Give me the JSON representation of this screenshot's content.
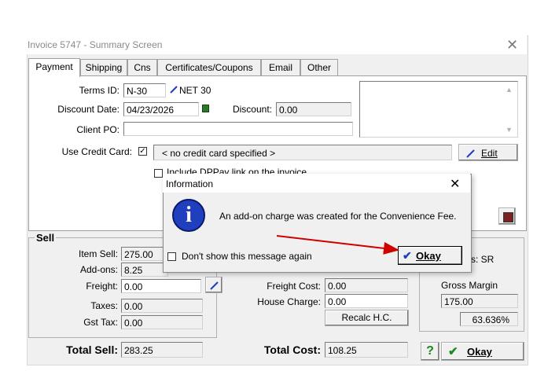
{
  "window": {
    "title": "Invoice 5747 - Summary Screen",
    "close_glyph": "✕"
  },
  "tabs": [
    "Payment",
    "Shipping",
    "Cns",
    "Certificates/Coupons",
    "Email",
    "Other"
  ],
  "payment": {
    "terms_label": "Terms ID:",
    "terms_value": "N-30",
    "terms_desc": "NET 30",
    "discount_date_label": "Discount Date:",
    "discount_date_value": "04/23/2026",
    "discount_label": "Discount:",
    "discount_value": "0.00",
    "client_po_label": "Client PO:",
    "client_po_value": "",
    "use_cc_label": "Use Credit Card:",
    "use_cc_checked": true,
    "cc_value": "< no credit card specified >",
    "edit_label": "Edit",
    "dppay_label": "Include DPPay link on the invoice"
  },
  "sell": {
    "group_label": "Sell",
    "item_sell_label": "Item Sell:",
    "item_sell_value": "275.00",
    "addons_label": "Add-ons:",
    "addons_value": "8.25",
    "freight_label": "Freight:",
    "freight_value": "0.00",
    "taxes_label": "Taxes:",
    "taxes_value": "0.00",
    "gst_label": "Gst Tax:",
    "gst_value": "0.00",
    "total_label": "Total Sell:",
    "total_value": "283.25"
  },
  "cost": {
    "freight_cost_label": "Freight Cost:",
    "freight_cost_value": "0.00",
    "house_charge_label": "House Charge:",
    "house_charge_value": "0.00",
    "recalc_label": "Recalc H.C.",
    "total_label": "Total Cost:",
    "total_value": "108.25"
  },
  "margin": {
    "status_text": "s: SR",
    "label": "Gross Margin",
    "value": "175.00",
    "percent": "63.636%"
  },
  "footer": {
    "help_glyph": "?",
    "okay_label": "Okay"
  },
  "dialog": {
    "title": "Information",
    "close_glyph": "✕",
    "info_glyph": "i",
    "message": "An add-on charge was created for the Convenience Fee.",
    "dont_show_label": "Don't show this message again",
    "okay_label": "Okay"
  },
  "colors": {
    "accent_blue": "#1f3fbf",
    "arrow_red": "#d00000",
    "check_green": "#1a8a1a"
  }
}
